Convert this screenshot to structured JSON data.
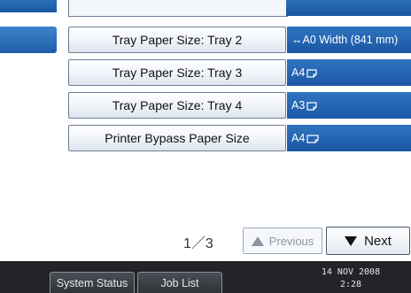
{
  "settings_list": {
    "rows": [
      {
        "label": "Tray Paper Size: Tray 2",
        "value": "↔A0 Width (841 mm)",
        "orientation_icon": ""
      },
      {
        "label": "Tray Paper Size: Tray 3",
        "value": "A4",
        "orientation_icon": "portrait-paper-icon"
      },
      {
        "label": "Tray Paper Size: Tray 4",
        "value": "A3",
        "orientation_icon": "portrait-paper-icon"
      },
      {
        "label": "Printer Bypass Paper Size",
        "value": "A4",
        "orientation_icon": "landscape-paper-icon"
      }
    ]
  },
  "pagination": {
    "page_indicator": "1／3",
    "previous_label": "Previous",
    "next_label": "Next"
  },
  "status_bar": {
    "system_status_label": "System Status",
    "job_list_label": "Job List",
    "date": "14 NOV  2008",
    "time": "2:28"
  },
  "colors": {
    "value_panel": "#1f5ea8",
    "status_bar_bg": "#222428"
  }
}
